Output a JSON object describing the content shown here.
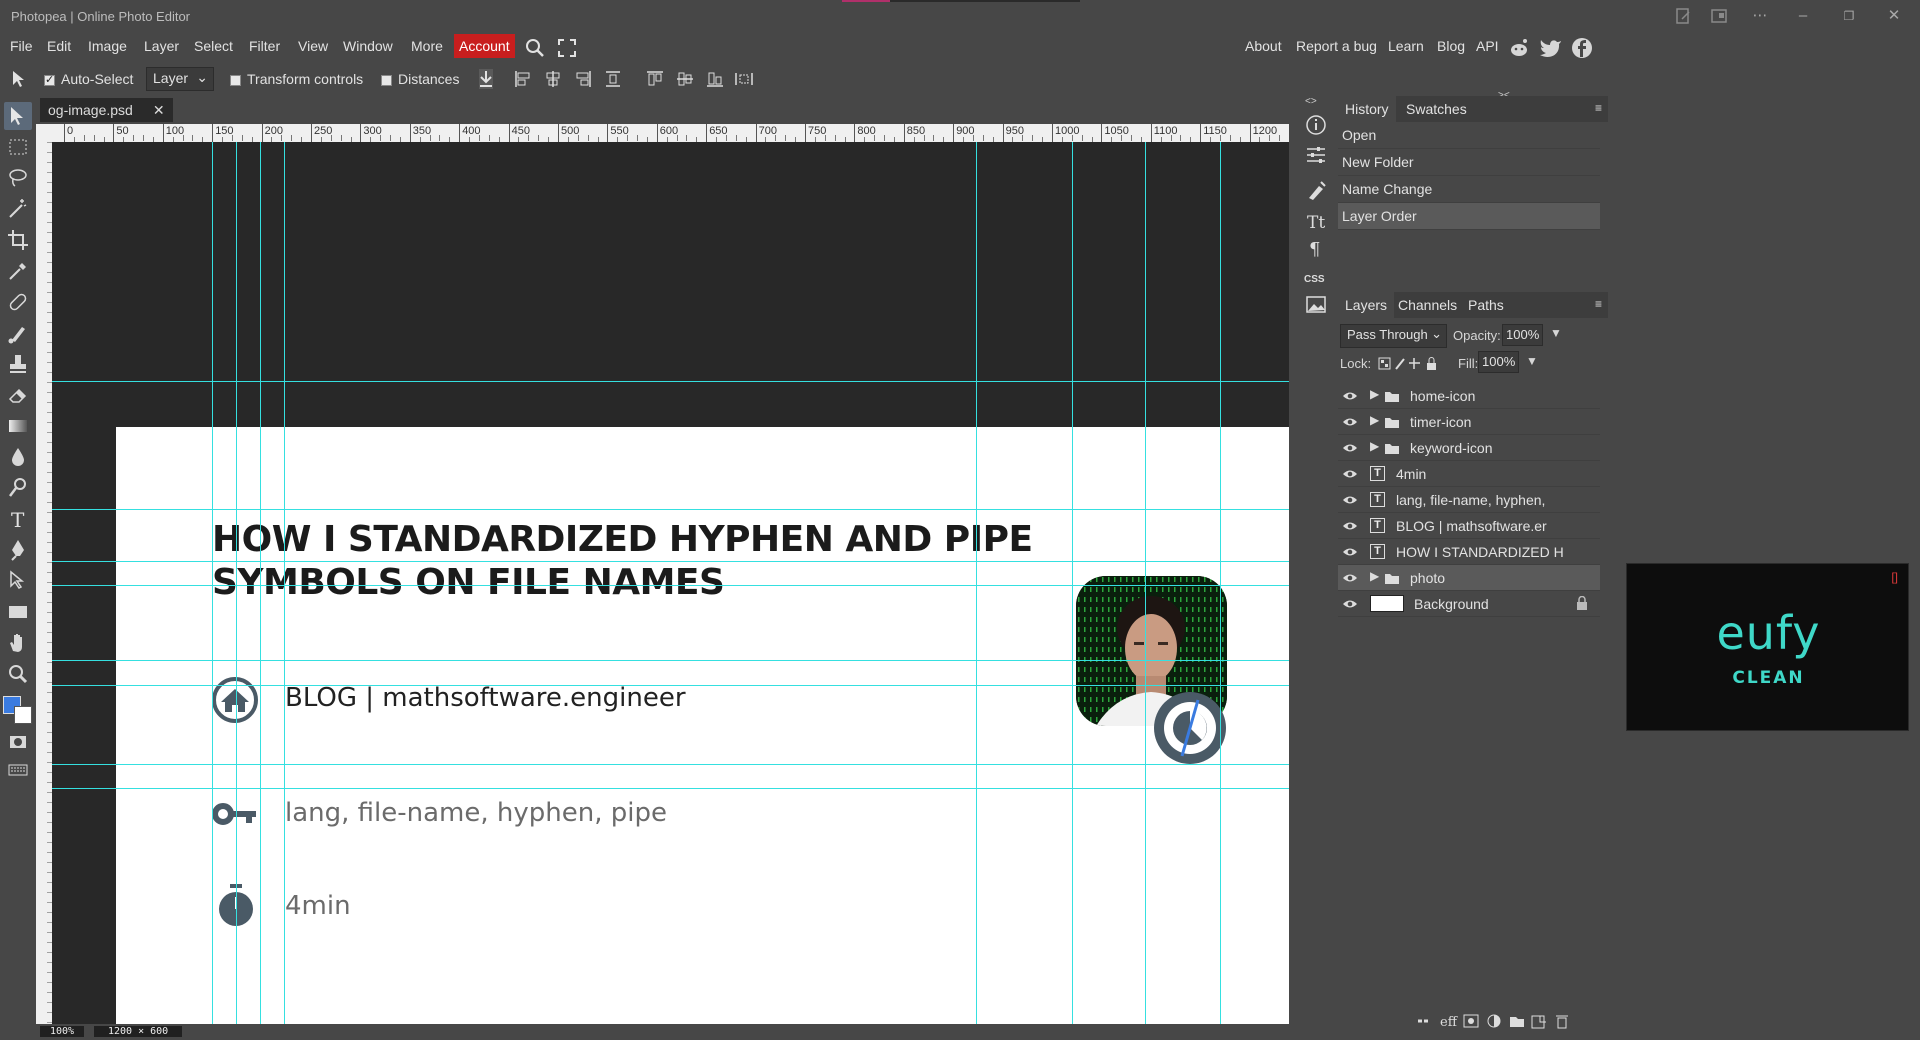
{
  "window": {
    "title": "Photopea | Online Photo Editor",
    "controls": [
      "minimize",
      "restore",
      "close"
    ]
  },
  "menu": {
    "items": [
      "File",
      "Edit",
      "Image",
      "Layer",
      "Select",
      "Filter",
      "View",
      "Window",
      "More"
    ],
    "account": "Account",
    "right_links": [
      "About",
      "Report a bug",
      "Learn",
      "Blog",
      "API"
    ]
  },
  "options": {
    "auto_select_label": "Auto-Select",
    "auto_select_checked": true,
    "layer_select": "Layer",
    "transform_label": "Transform controls",
    "distances_label": "Distances"
  },
  "document": {
    "tab_name": "og-image.psd",
    "zoom": "100%",
    "size": "1200 × 600",
    "ruler_ticks": [
      "0",
      "50",
      "100",
      "150",
      "200",
      "250",
      "300",
      "350",
      "400",
      "450",
      "500",
      "550",
      "600",
      "650",
      "700",
      "750",
      "800",
      "850",
      "900",
      "950",
      "1000",
      "1050",
      "1100",
      "1150",
      "1200"
    ]
  },
  "canvas": {
    "title": "HOW I STANDARDIZED HYPHEN AND PIPE SYMBOLS ON FILE NAMES",
    "blog": "BLOG | mathsoftware.engineer",
    "keywords": "lang, file-name, hyphen, pipe",
    "read_time": "4min",
    "guide_color": "#35e0e0"
  },
  "history": {
    "tabs": [
      "History",
      "Swatches"
    ],
    "items": [
      "Open",
      "New Folder",
      "Name Change",
      "Layer Order"
    ]
  },
  "layers": {
    "tabs": [
      "Layers",
      "Channels",
      "Paths"
    ],
    "blend_mode": "Pass Through",
    "opacity_label": "Opacity:",
    "opacity": "100%",
    "lock_label": "Lock:",
    "fill_label": "Fill:",
    "fill": "100%",
    "items": [
      {
        "name": "home-icon",
        "type": "folder"
      },
      {
        "name": "timer-icon",
        "type": "folder"
      },
      {
        "name": "keyword-icon",
        "type": "folder"
      },
      {
        "name": "4min",
        "type": "text"
      },
      {
        "name": "lang, file-name, hyphen,",
        "type": "text"
      },
      {
        "name": "BLOG | mathsoftware.er",
        "type": "text"
      },
      {
        "name": "HOW I STANDARDIZED H",
        "type": "text"
      },
      {
        "name": "photo",
        "type": "folder"
      },
      {
        "name": "Background",
        "type": "raster"
      }
    ]
  },
  "ad": {
    "brand": "eufy",
    "tagline": "CLEAN"
  }
}
